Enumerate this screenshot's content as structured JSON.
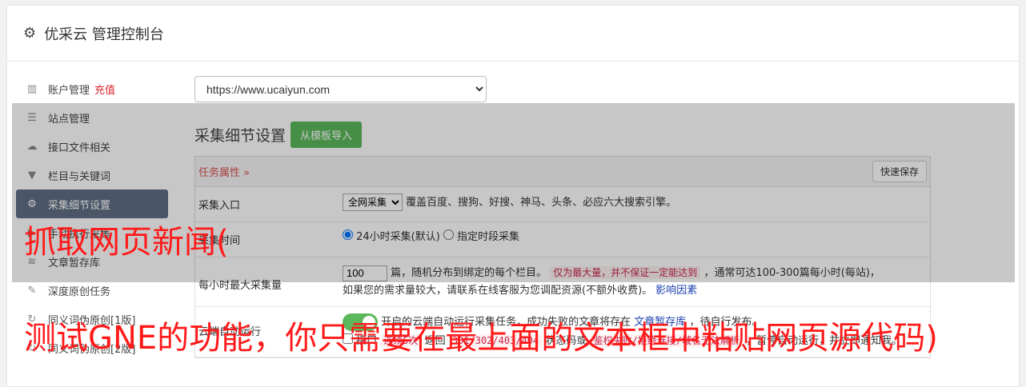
{
  "header": {
    "title": "优采云 管理控制台",
    "icon": "gear-icon"
  },
  "sidebar": {
    "items": [
      {
        "label": "账户管理",
        "badge": "充值",
        "icon": "bar-chart-icon"
      },
      {
        "label": "站点管理",
        "icon": "server-icon"
      },
      {
        "label": "接口文件相关",
        "icon": "cloud-upload-icon"
      },
      {
        "label": "栏目与关键词",
        "icon": "filter-icon"
      },
      {
        "label": "采集细节设置",
        "icon": "gears-icon",
        "active": true
      },
      {
        "label": "手动执行采集",
        "icon": "play-icon"
      },
      {
        "label": "文章暂存库",
        "icon": "database-icon"
      },
      {
        "label": "深度原创任务",
        "icon": "edit-icon"
      },
      {
        "label": "同义词伪原创[1版]",
        "icon": "refresh-icon"
      },
      {
        "label": "同义词伪原创[2版]",
        "icon": "refresh-icon"
      }
    ]
  },
  "main": {
    "site_select": "https://www.ucaiyun.com",
    "section_title": "采集细节设置",
    "import_button": "从模板导入",
    "panel": {
      "head_label": "任务属性 »",
      "save_button": "快速保存",
      "rows": {
        "entry": {
          "label": "采集入口",
          "select": "全网采集",
          "desc": "覆盖百度、搜狗、好搜、神马、头条、必应六大搜索引擎。"
        },
        "time": {
          "label": "采集时间",
          "opt1": "24小时采集(默认)",
          "opt2": "指定时段采集"
        },
        "max": {
          "label": "每小时最大采集量",
          "value": "100",
          "text1": "篇，随机分布到绑定的每个栏目。",
          "tag": "仅为最大量，并不保证一定能达到",
          "text2": "，通常可达100-300篇每小时(每站)，",
          "text3": "如果您的需求量较大，请联系在线客服为您调配资源(不额外收费)。",
          "link": "影响因素"
        },
        "auto": {
          "label": "云端自动运行",
          "desc": "开启的云端自动运行采集任务，成功失败的文章将存在",
          "link": "文章暂存库",
          "desc2": "，待自行发布。",
          "cb_label": "接口",
          "tag1": "连续5次",
          "t1": "返回",
          "tag2": "301/302/403/404",
          "t2": "状态码或",
          "tag3": "鉴权失败/拒绝连接/域名无法解析",
          "t3": "，暂停自动运行，并立即通知我。"
        }
      }
    }
  },
  "captions": {
    "line1": "抓取网页新闻(",
    "line2": "测试GNE的功能，你只需要在最上面的文本框中粘贴网页源代码)"
  }
}
